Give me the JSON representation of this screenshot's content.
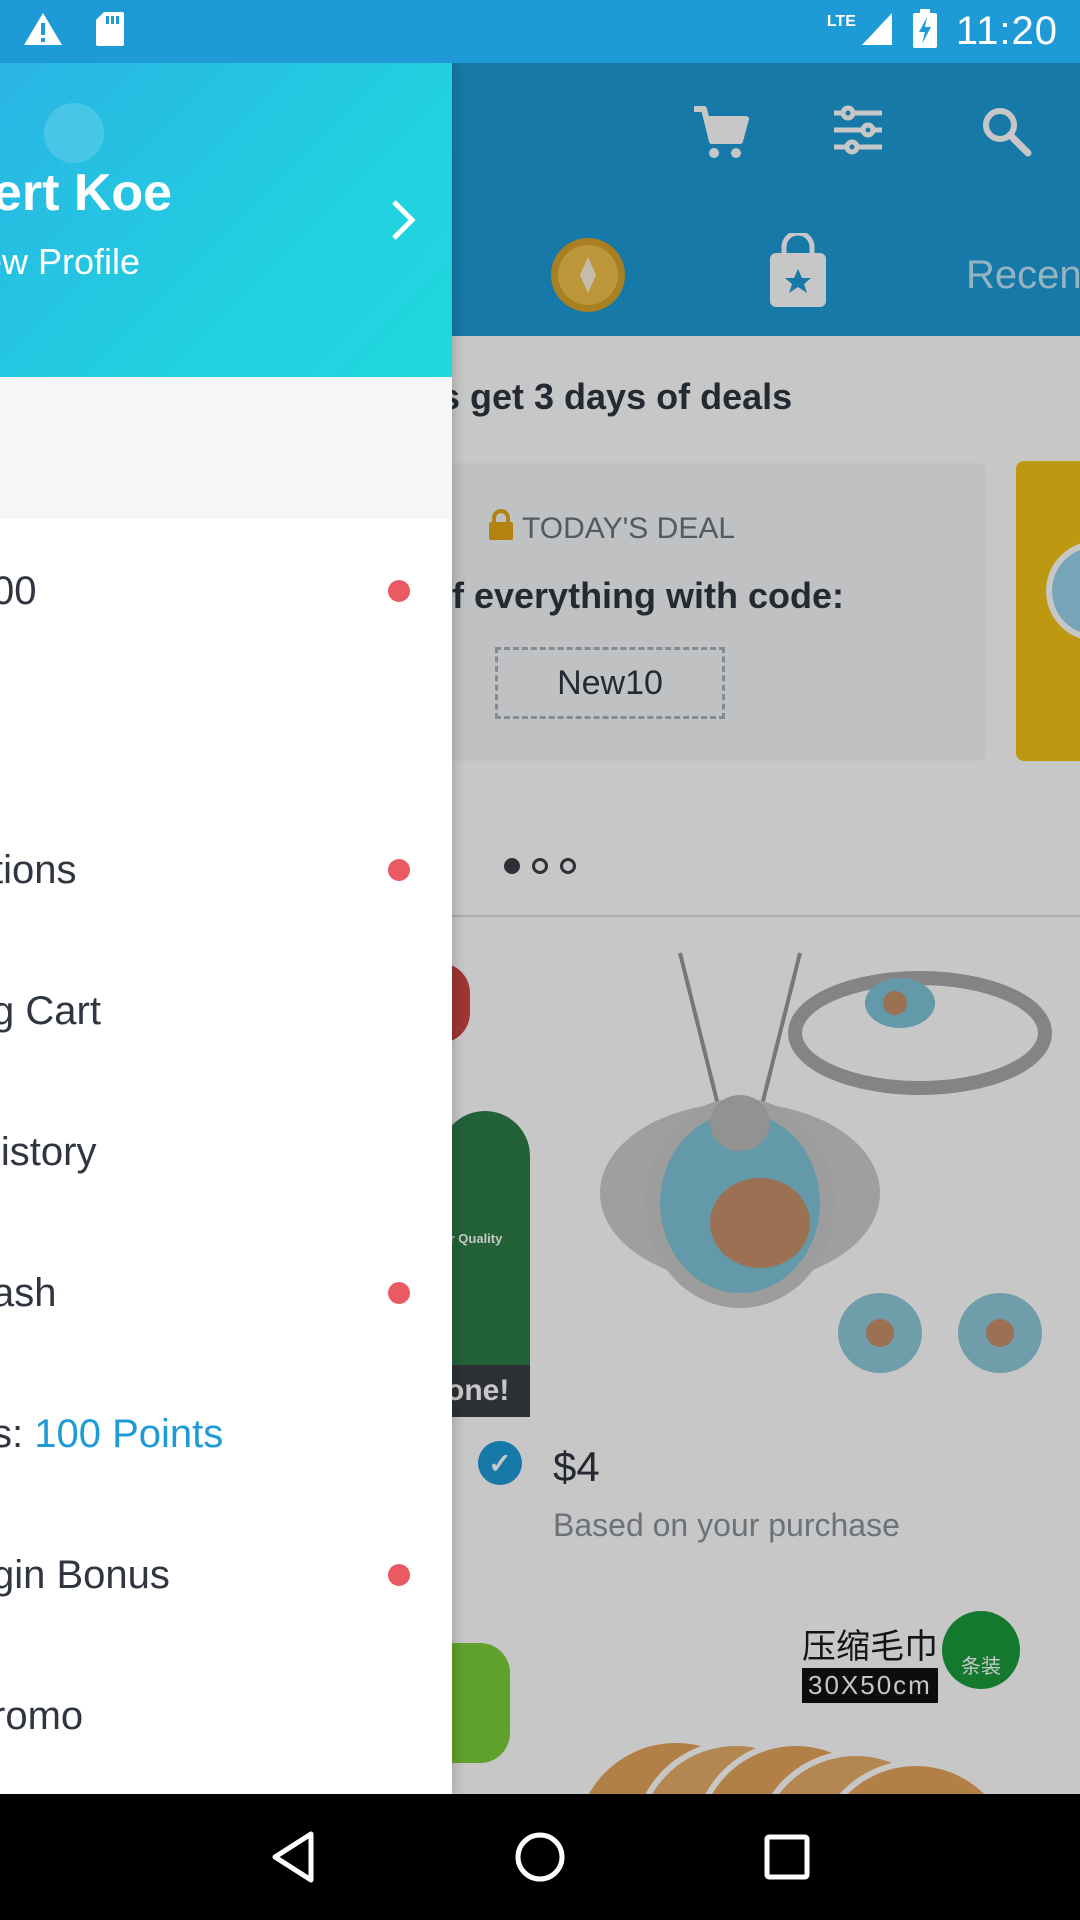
{
  "status_bar": {
    "network": "LTE",
    "time": "11:20",
    "icons": [
      "warning-icon",
      "sd-card-icon",
      "signal-icon",
      "battery-charging-icon"
    ]
  },
  "app": {
    "header_icons": [
      "cart-icon",
      "filter-icon",
      "search-icon"
    ],
    "tabs": [
      {
        "icon": "coin-icon",
        "label": ""
      },
      {
        "icon": "bag-star-icon",
        "label": ""
      },
      {
        "label": "Recen"
      }
    ],
    "promo_title": "s get 3 days of deals",
    "deal": {
      "label": "TODAY'S DEAL",
      "text": "ff everything with code:",
      "code": "New10"
    },
    "carousel": {
      "count": 3,
      "active": 0
    },
    "product": {
      "price": "$4",
      "subtitle": "Based on your purchase"
    },
    "side_product": {
      "caption": "one!",
      "small_text": "ir Quality"
    },
    "towel": {
      "title": "压缩毛巾",
      "size": "30X50cm",
      "badge": "条装"
    }
  },
  "drawer": {
    "user_name": "sert Koe",
    "profile_link": "ew Profile",
    "items": [
      {
        "label": "00",
        "dot": true
      },
      {
        "label": "tions",
        "dot": true
      },
      {
        "label": "g Cart",
        "dot": false
      },
      {
        "label": "listory",
        "dot": false
      },
      {
        "label": "ash",
        "dot": true
      },
      {
        "label_prefix": "s: ",
        "label_accent": "100 Points",
        "dot": false
      },
      {
        "label": "gin Bonus",
        "dot": true
      },
      {
        "label": "romo",
        "dot": false
      }
    ]
  },
  "nav_bar": {
    "buttons": [
      "back-icon",
      "home-icon",
      "recents-icon"
    ]
  },
  "colors": {
    "primary": "#1e9bd6",
    "drawer_gradient_end": "#20d8de",
    "notification_dot": "#ea5a63",
    "text_dark": "#2f3640"
  }
}
